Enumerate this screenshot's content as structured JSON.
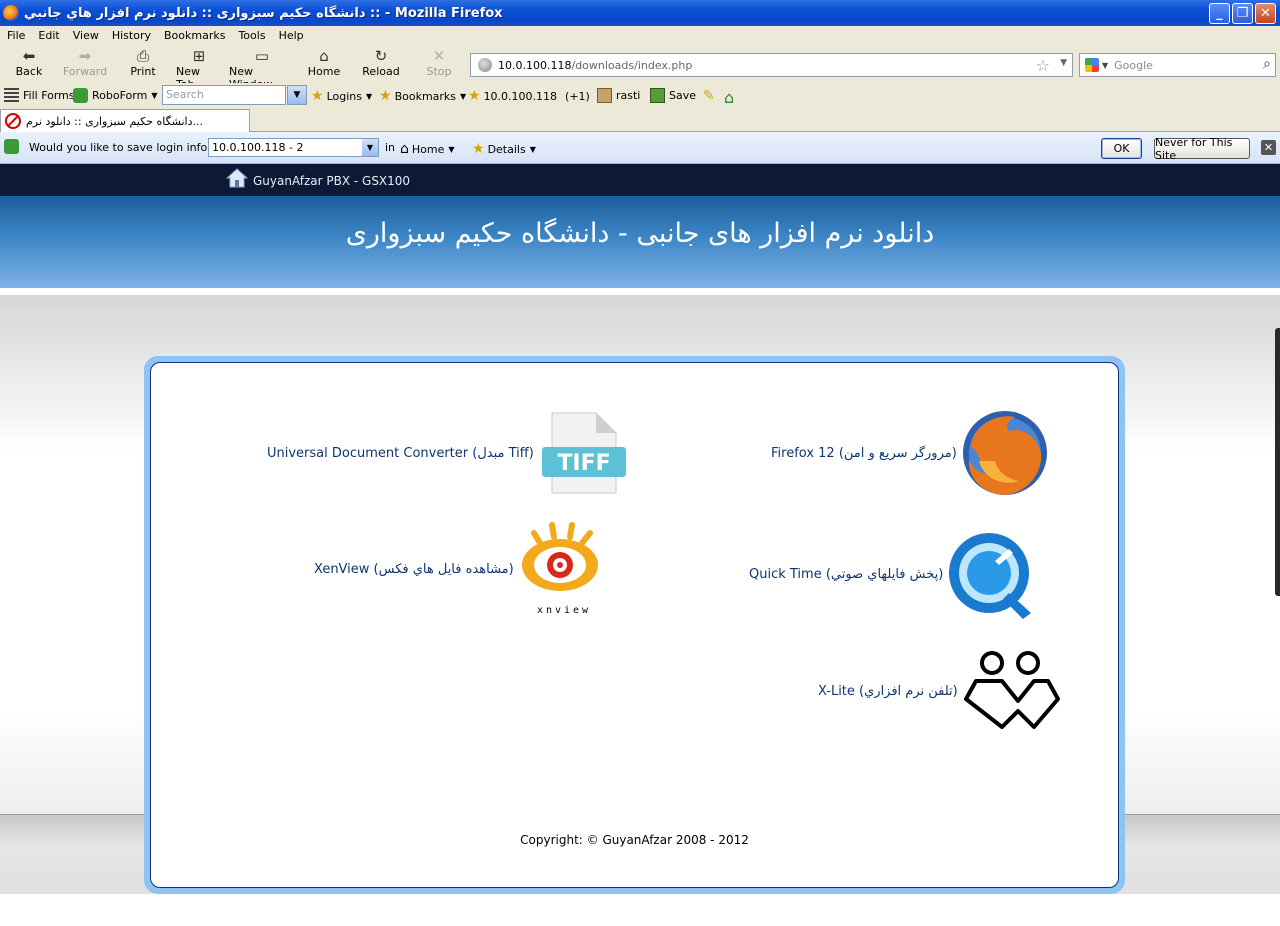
{
  "window": {
    "title": "دانشگاه حکیم سبزواری :: دانلود نرم افزار هاي جانبي :: - Mozilla Firefox"
  },
  "menu": [
    "File",
    "Edit",
    "View",
    "History",
    "Bookmarks",
    "Tools",
    "Help"
  ],
  "nav": {
    "back": "Back",
    "forward": "Forward",
    "print": "Print",
    "new_tab": "New Tab",
    "new_window": "New Window",
    "home": "Home",
    "reload": "Reload",
    "stop": "Stop",
    "url_host": "10.0.100.118",
    "url_path": "/downloads/index.php",
    "search_placeholder": "Google"
  },
  "roboform": {
    "fill_forms": "Fill Forms",
    "roboform": "RoboForm",
    "search_placeholder": "Search",
    "logins": "Logins",
    "bookmarks": "Bookmarks",
    "site": "10.0.100.118",
    "site_count": "(+1)",
    "user": "rasti",
    "save": "Save"
  },
  "tab": {
    "label": "دانشگاه حکیم سبزواری :: دانلود نرم..."
  },
  "loginbar": {
    "question": "Would you like to save login info as:",
    "selected": "10.0.100.118 - 2",
    "in": "in",
    "home": "Home",
    "details": "Details",
    "ok": "OK",
    "never": "Never for This Site"
  },
  "page": {
    "pbx_title": "GuyanAfzar PBX - GSX100",
    "heading": "دانلود نرم افزار های جانبی - دانشگاه حکیم سبزواری",
    "items": {
      "firefox": "Firefox 12 (مرورگر سریع و امن)",
      "tiff": "Universal Document Converter (مبدل Tiff)",
      "quicktime": "Quick Time (پخش فایلهاي صوتي)",
      "xnview": "XenView (مشاهده فایل هاي فکس)",
      "xlite": "X-Lite (تلفن نرم افزاري)"
    },
    "tiff_badge": "TIFF",
    "xnview_logo": "xnview",
    "copyright": "Copyright: © GuyanAfzar 2008 - 2012"
  },
  "colors": {
    "title_bar": "#0a4fd6",
    "header_top": "#1b5e9c",
    "panel_border": "#8dc3f5",
    "link_text": "#0d3570"
  }
}
